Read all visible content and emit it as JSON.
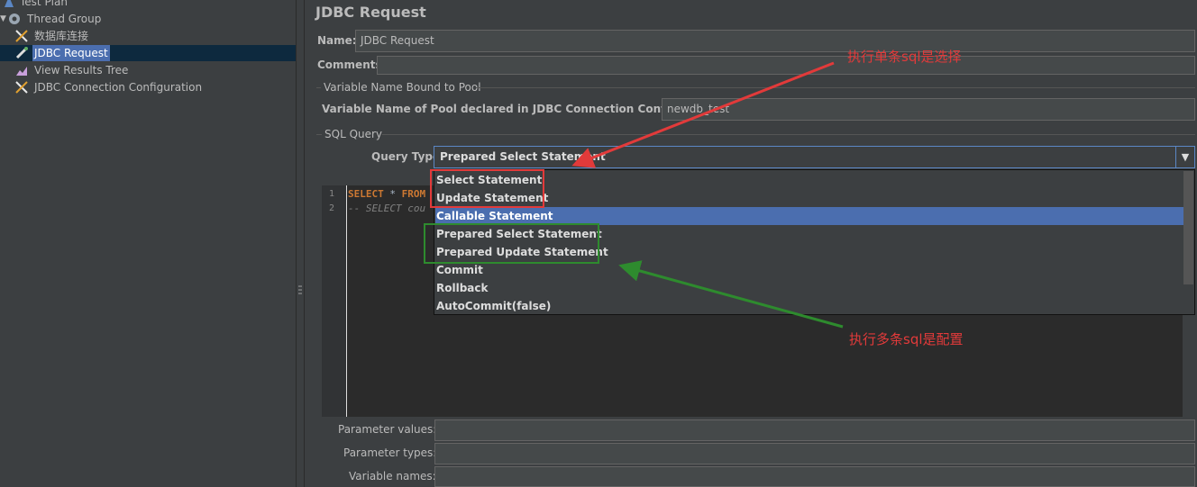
{
  "tree": {
    "items": [
      {
        "label": "Test Plan"
      },
      {
        "label": "Thread Group"
      },
      {
        "label": "数据库连接"
      },
      {
        "label": "JDBC Request"
      },
      {
        "label": "View Results Tree"
      },
      {
        "label": "JDBC Connection Configuration"
      }
    ]
  },
  "panel": {
    "title": "JDBC Request",
    "name_label": "Name:",
    "name_value": "JDBC Request",
    "comments_label": "Comments:",
    "pool_group_title": "Variable Name Bound to Pool",
    "pool_label": "Variable Name of Pool declared in JDBC Connection Configuration:",
    "pool_value": "newdb_test",
    "sql_group_title": "SQL Query",
    "query_type_label": "Query Type:",
    "query_type_value": "Prepared Select Statement",
    "combo_arrow": "▼"
  },
  "editor": {
    "lines": [
      {
        "num": "1",
        "keyword": "SELECT",
        "rest": " * ",
        "keyword2": "FROM"
      },
      {
        "num": "2",
        "comment": "-- SELECT cou"
      }
    ]
  },
  "dropdown": {
    "options": [
      "Select Statement",
      "Update Statement",
      "Callable Statement",
      "Prepared Select Statement",
      "Prepared Update Statement",
      "Commit",
      "Rollback",
      "AutoCommit(false)"
    ],
    "highlighted_index": 2
  },
  "params": {
    "values_label": "Parameter values:",
    "types_label": "Parameter types:",
    "names_label": "Variable names:"
  },
  "annotations": {
    "top_note": "执行单条sql是选择",
    "bottom_note": "执行多条sql是配置",
    "red_color": "#e23a3a",
    "green_color": "#2e8b2e"
  }
}
